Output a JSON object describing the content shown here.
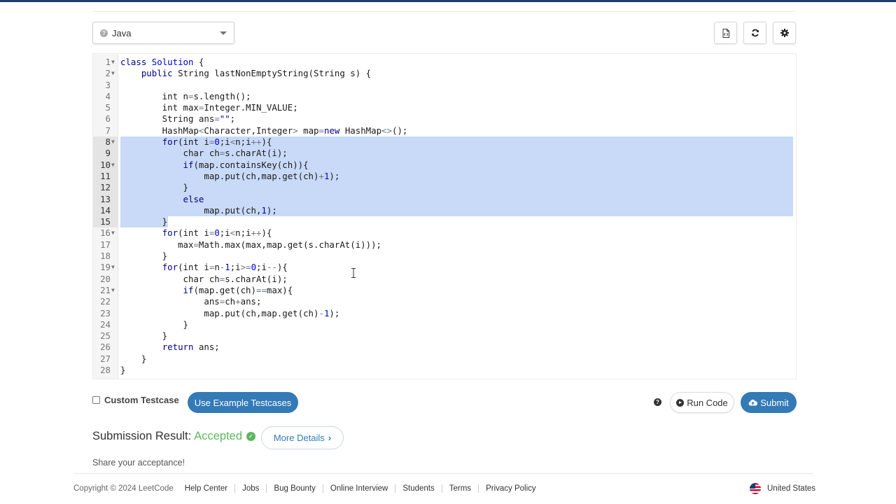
{
  "editor": {
    "language": "Java",
    "lines": [
      {
        "n": "1",
        "fold": true,
        "html": "<span class=\"k\">class</span> <span class=\"n\">Solution</span> {"
      },
      {
        "n": "2",
        "fold": true,
        "html": "    <span class=\"k\">public</span> String lastNonEmptyString(String s) {"
      },
      {
        "n": "3",
        "fold": false,
        "html": ""
      },
      {
        "n": "4",
        "fold": false,
        "html": "        int n<span class=\"o\">=</span>s.length();"
      },
      {
        "n": "5",
        "fold": false,
        "html": "        int max<span class=\"o\">=</span>Integer.MIN_VALUE;"
      },
      {
        "n": "6",
        "fold": false,
        "html": "        String ans<span class=\"o\">=</span><span class=\"n\">\"\"</span>;"
      },
      {
        "n": "7",
        "fold": false,
        "html": "        HashMap<span class=\"o\">&lt;</span>Character,Integer<span class=\"o\">&gt;</span> map<span class=\"o\">=</span><span class=\"k\">new</span> HashMap<span class=\"o\">&lt;&gt;</span>();"
      },
      {
        "n": "8",
        "fold": true,
        "sel": "full",
        "html": "        <span class=\"k\">for</span>(int i<span class=\"o\">=</span><span class=\"n\">0</span>;i<span class=\"o\">&lt;</span>n;i<span class=\"o\">++</span>){"
      },
      {
        "n": "9",
        "fold": false,
        "sel": "full",
        "html": "            char ch<span class=\"o\">=</span>s.charAt(i);"
      },
      {
        "n": "10",
        "fold": true,
        "sel": "full",
        "html": "            <span class=\"k\">if</span>(map.containsKey(ch)){"
      },
      {
        "n": "11",
        "fold": false,
        "sel": "full",
        "html": "                map.put(ch,map.get(ch)<span class=\"o\">+</span><span class=\"n\">1</span>);"
      },
      {
        "n": "12",
        "fold": false,
        "sel": "full",
        "html": "            }"
      },
      {
        "n": "13",
        "fold": false,
        "sel": "full",
        "html": "            <span class=\"k\">else</span>"
      },
      {
        "n": "14",
        "fold": false,
        "sel": "full",
        "html": "                map.put(ch,<span class=\"n\">1</span>);"
      },
      {
        "n": "15",
        "fold": false,
        "sel": "end",
        "html": "        }"
      },
      {
        "n": "16",
        "fold": true,
        "html": "        <span class=\"k\">for</span>(int i<span class=\"o\">=</span><span class=\"n\">0</span>;i<span class=\"o\">&lt;</span>n;i<span class=\"o\">++</span>){"
      },
      {
        "n": "17",
        "fold": false,
        "html": "           max<span class=\"o\">=</span>Math.max(max,map.get(s.charAt(i)));"
      },
      {
        "n": "18",
        "fold": false,
        "html": "        }"
      },
      {
        "n": "19",
        "fold": true,
        "html": "        <span class=\"k\">for</span>(int i<span class=\"o\">=</span>n<span class=\"o\">-</span><span class=\"n\">1</span>;i<span class=\"o\">&gt;=</span><span class=\"n\">0</span>;i<span class=\"o\">--</span>){"
      },
      {
        "n": "20",
        "fold": false,
        "html": "            char ch<span class=\"o\">=</span>s.charAt(i);"
      },
      {
        "n": "21",
        "fold": true,
        "html": "            <span class=\"k\">if</span>(map.get(ch)<span class=\"o\">==</span>max){"
      },
      {
        "n": "22",
        "fold": false,
        "html": "                ans<span class=\"o\">=</span>ch<span class=\"o\">+</span>ans;"
      },
      {
        "n": "23",
        "fold": false,
        "html": "                map.put(ch,map.get(ch)<span class=\"o\">-</span><span class=\"n\">1</span>);"
      },
      {
        "n": "24",
        "fold": false,
        "html": "            }"
      },
      {
        "n": "25",
        "fold": false,
        "html": "        }"
      },
      {
        "n": "26",
        "fold": false,
        "html": "        <span class=\"k\">return</span> ans;"
      },
      {
        "n": "27",
        "fold": false,
        "html": "    }"
      },
      {
        "n": "28",
        "fold": false,
        "html": "}"
      }
    ]
  },
  "toolbar": {
    "icons": [
      "file-code-icon",
      "refresh-icon",
      "settings-gear-icon"
    ]
  },
  "testcase": {
    "custom_label": "Custom Testcase",
    "example_button": "Use Example Testcases",
    "run_button": "Run Code",
    "submit_button": "Submit"
  },
  "result": {
    "label": "Submission Result:",
    "status": "Accepted",
    "details_button": "More Details",
    "share_text": "Share your acceptance!"
  },
  "footer": {
    "copyright": "Copyright © 2024 LeetCode",
    "links": [
      "Help Center",
      "Jobs",
      "Bug Bounty",
      "Online Interview",
      "Students",
      "Terms",
      "Privacy Policy"
    ],
    "region": "United States"
  },
  "colors": {
    "accent": "#337ab7",
    "accepted": "#5cb85c",
    "selection": "#c8daf7"
  }
}
